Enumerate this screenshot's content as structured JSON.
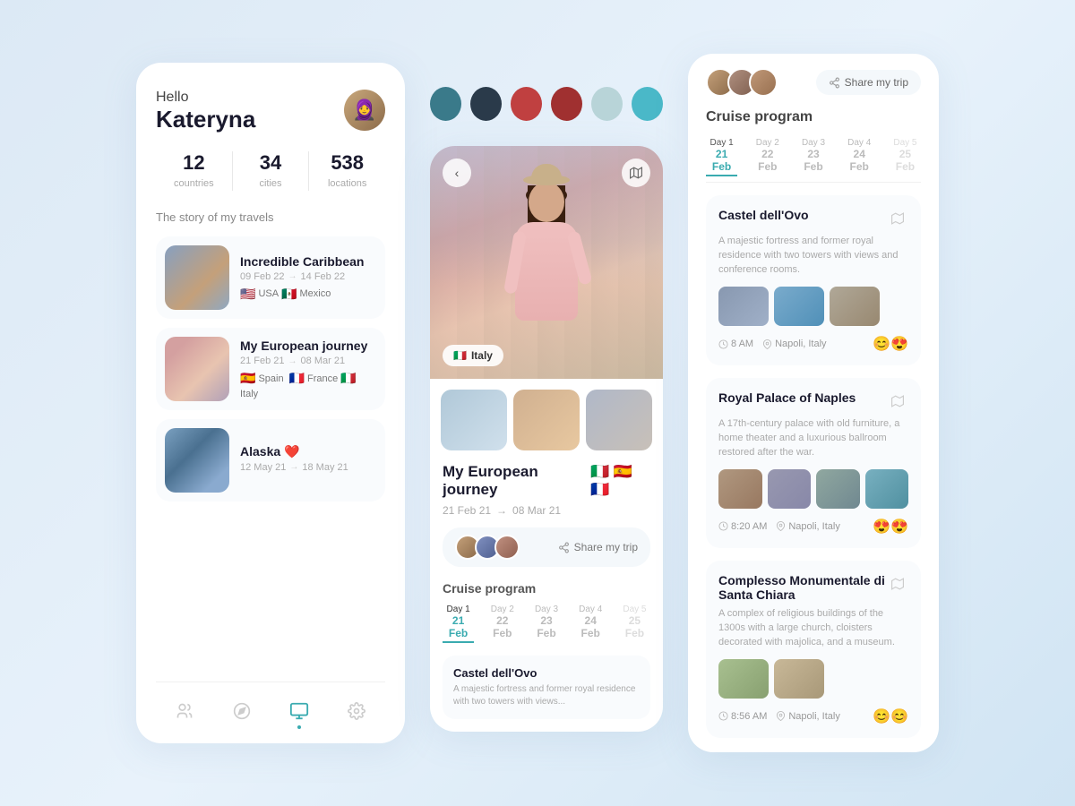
{
  "app": {
    "background": "#dce9f5"
  },
  "left": {
    "greeting_hello": "Hello",
    "greeting_name": "Kateryna",
    "stats": [
      {
        "number": "12",
        "label": "countries"
      },
      {
        "number": "34",
        "label": "cities"
      },
      {
        "number": "538",
        "label": "locations"
      }
    ],
    "section_title": "The story of my travels",
    "trips": [
      {
        "name": "Incredible Caribbean",
        "date_from": "09 Feb 22",
        "date_to": "14 Feb 22",
        "flags": [
          "🇺🇸",
          "🇲🇽"
        ],
        "flag_labels": [
          "USA",
          "Mexico"
        ],
        "thumb_class": "trip-thumb-caribbean"
      },
      {
        "name": "My European journey",
        "date_from": "21 Feb 21",
        "date_to": "08 Mar 21",
        "flags": [
          "🇪🇸",
          "🇫🇷",
          "🇮🇹"
        ],
        "flag_labels": [
          "Spain",
          "France",
          "Italy"
        ],
        "thumb_class": "trip-thumb-european"
      },
      {
        "name": "Alaska ❤️",
        "date_from": "12 May 21",
        "date_to": "18 May 21",
        "flags": [],
        "flag_labels": [],
        "thumb_class": "trip-thumb-alaska"
      }
    ],
    "nav": [
      {
        "icon": "👥",
        "active": false,
        "name": "people-nav"
      },
      {
        "icon": "🧭",
        "active": false,
        "name": "compass-nav"
      },
      {
        "icon": "📋",
        "active": true,
        "name": "trips-nav"
      },
      {
        "icon": "⚙️",
        "active": false,
        "name": "settings-nav"
      }
    ]
  },
  "swatches": [
    {
      "color": "#3a7a8a",
      "name": "teal-dark"
    },
    {
      "color": "#2a3a4a",
      "name": "navy"
    },
    {
      "color": "#c04040",
      "name": "red-brick"
    },
    {
      "color": "#a03030",
      "name": "dark-red"
    },
    {
      "color": "#b8d4d8",
      "name": "light-teal"
    },
    {
      "color": "#4ab8c8",
      "name": "cyan"
    }
  ],
  "mid": {
    "hero_location": "Italy",
    "hero_location_flag": "🇮🇹",
    "trip_title": "My European journey",
    "trip_flags": [
      "🇮🇹",
      "🇪🇸",
      "🇫🇷"
    ],
    "date_from": "21 Feb 21",
    "date_to": "08 Mar 21",
    "share_label": "Share my trip",
    "cruise_title": "Cruise program",
    "days": [
      {
        "label": "Day 1",
        "date": "21 Feb",
        "active": true
      },
      {
        "label": "Day 2",
        "date": "22 Feb",
        "active": false
      },
      {
        "label": "Day 3",
        "date": "23 Feb",
        "active": false
      },
      {
        "label": "Day 4",
        "date": "24 Feb",
        "active": false
      },
      {
        "label": "Day 5",
        "date": "25 Feb",
        "active": false
      }
    ],
    "first_place": {
      "name": "Castel dell'Ovo",
      "desc": "A majestic fortress and former royal residence with two towers with views..."
    }
  },
  "right": {
    "share_label": "Share my trip",
    "cruise_title": "Cruise program",
    "days": [
      {
        "label": "Day 1",
        "date": "21 Feb",
        "active": true
      },
      {
        "label": "Day 2",
        "date": "22 Feb",
        "active": false
      },
      {
        "label": "Day 3",
        "date": "23 Feb",
        "active": false
      },
      {
        "label": "Day 4",
        "date": "24 Feb",
        "active": false
      },
      {
        "label": "Day 5",
        "date": "25 Feb",
        "active": false
      }
    ],
    "places": [
      {
        "name": "Castel dell'Ovo",
        "desc": "A majestic fortress and former royal residence with two towers with views and conference rooms.",
        "time": "8 AM",
        "location": "Napoli, Italy",
        "reactions": "😊😍",
        "thumbs": [
          "pt1",
          "pt2",
          "pt3"
        ]
      },
      {
        "name": "Royal Palace of Naples",
        "desc": "A 17th-century palace with old furniture, a home theater and a luxurious ballroom restored after the war.",
        "time": "8:20 AM",
        "location": "Napoli, Italy",
        "reactions": "😍😍",
        "thumbs": [
          "pt4",
          "pt5",
          "pt6",
          "pt7"
        ]
      },
      {
        "name": "Complesso Monumentale di Santa Chiara",
        "desc": "A complex of religious buildings of the 1300s with a large church, cloisters decorated with majolica, and a museum.",
        "time": "8:56 AM",
        "location": "Napoli, Italy",
        "reactions": "😊😊",
        "thumbs": [
          "pt9",
          "pt11"
        ]
      }
    ]
  }
}
